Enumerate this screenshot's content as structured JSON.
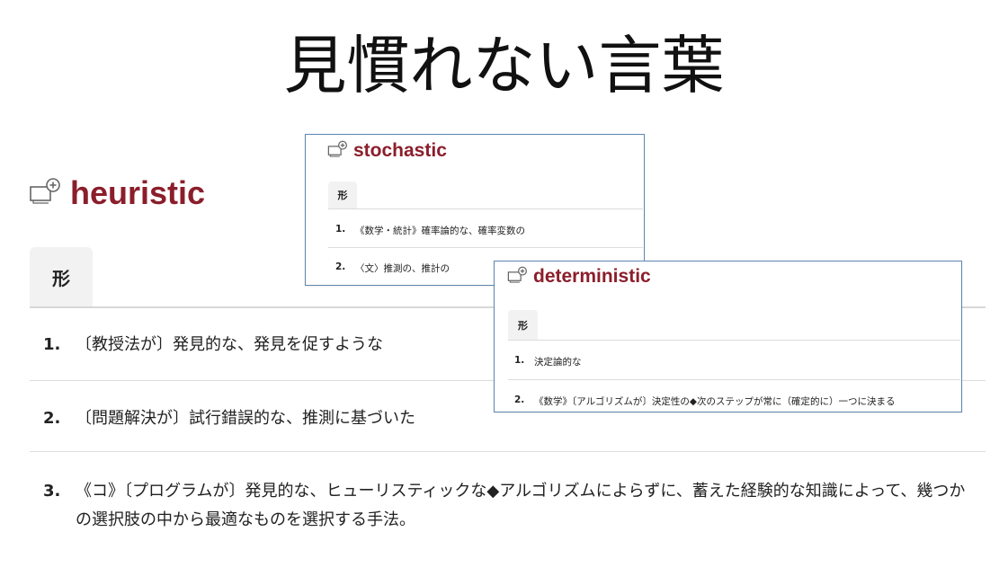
{
  "title": "見慣れない言葉",
  "heuristic": {
    "word": "heuristic",
    "pos": "形",
    "defs": [
      {
        "num": "1.",
        "text": "〔教授法が〕発見的な、発見を促すような"
      },
      {
        "num": "2.",
        "text": "〔問題解決が〕試行錯誤的な、推測に基づいた"
      },
      {
        "num": "3.",
        "text": "《コ》〔プログラムが〕発見的な、ヒューリスティックな◆アルゴリズムによらずに、蓄えた経験的な知識によって、幾つかの選択肢の中から最適なものを選択する手法。"
      }
    ]
  },
  "stochastic": {
    "word": "stochastic",
    "pos": "形",
    "defs": [
      {
        "num": "1.",
        "text": "《数学・統計》確率論的な、確率変数の"
      },
      {
        "num": "2.",
        "text": "〈文〉推測の、推計の"
      }
    ]
  },
  "deterministic": {
    "word": "deterministic",
    "pos": "形",
    "defs": [
      {
        "num": "1.",
        "text": "決定論的な"
      },
      {
        "num": "2.",
        "text": "《数学》〔アルゴリズムが〕決定性の◆次のステップが常に（確定的に）一つに決まる"
      }
    ]
  },
  "icon": "add-to-wordbook-icon",
  "colors": {
    "headword": "#8b1e2b",
    "card_border": "#5f86b0",
    "tab_bg": "#f2f2f2"
  }
}
